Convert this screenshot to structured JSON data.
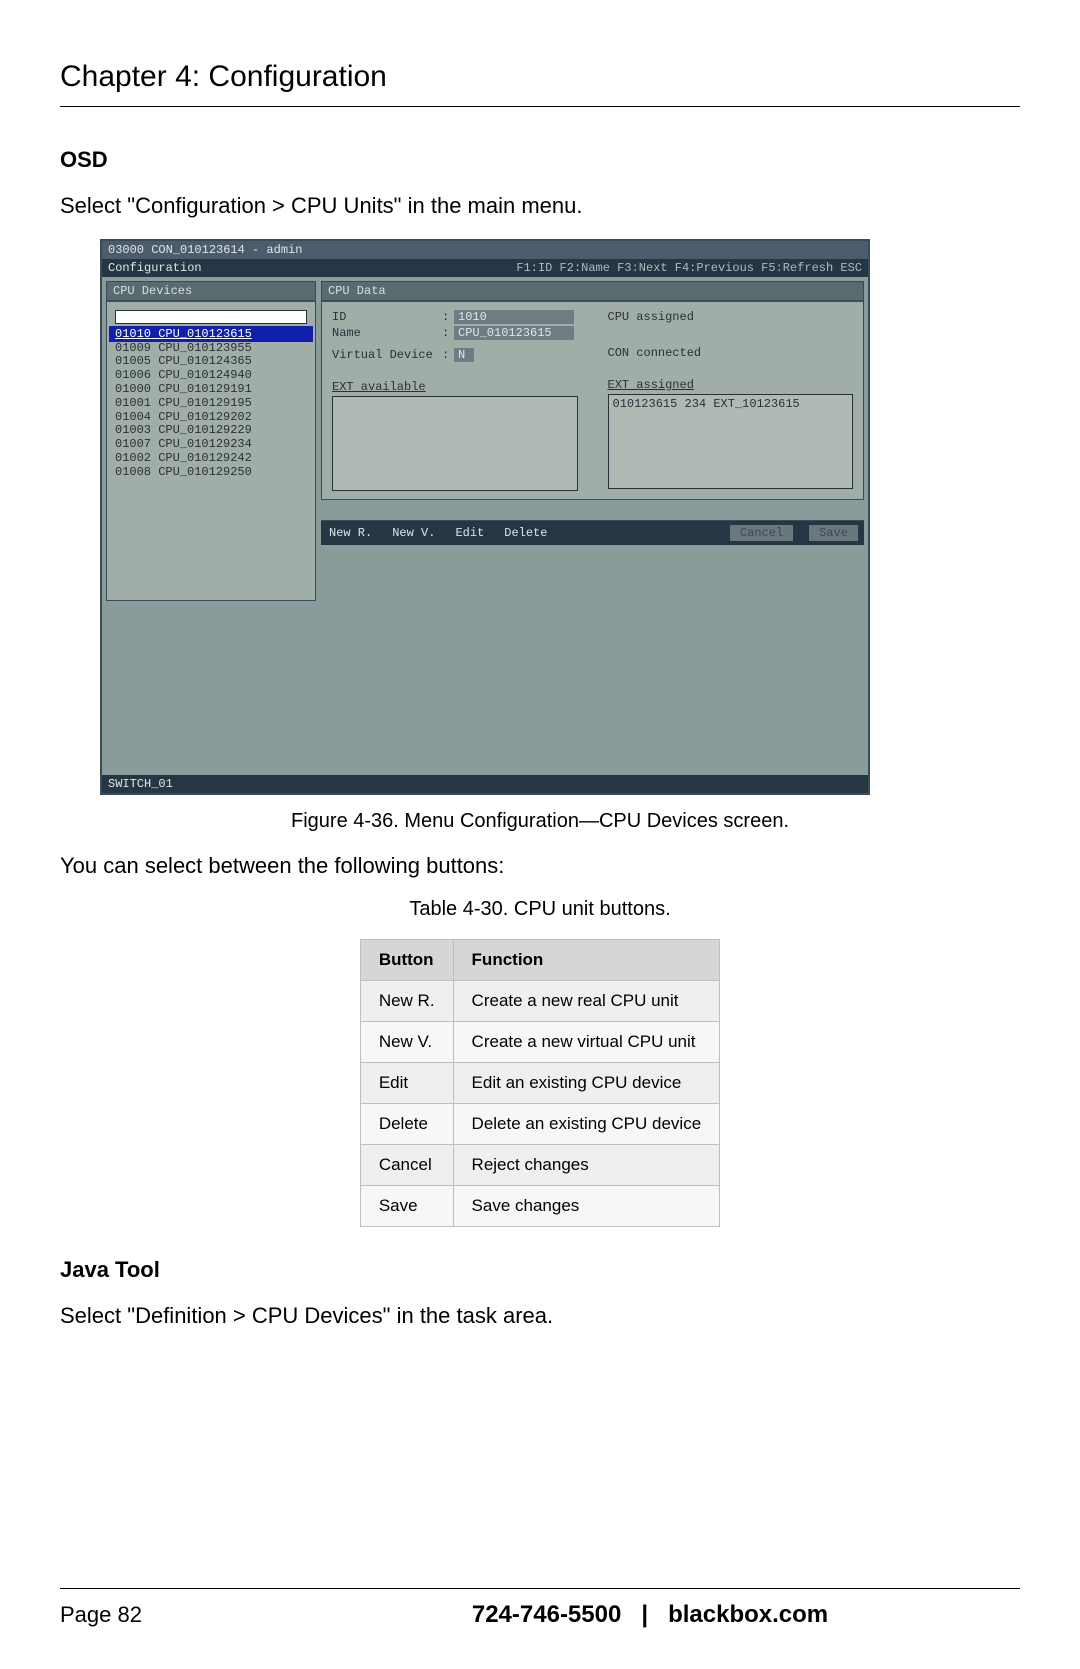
{
  "chapterTitle": "Chapter 4: Configuration",
  "sections": {
    "osd": {
      "title": "OSD",
      "intro": "Select \"Configuration > CPU Units\" in the main menu."
    },
    "java": {
      "title": "Java Tool",
      "intro": "Select \"Definition > CPU Devices\" in the task area."
    }
  },
  "osdScreen": {
    "titlebar": "03000 CON_010123614 - admin",
    "topbar": {
      "left": "Configuration",
      "right": "F1:ID  F2:Name  F3:Next  F4:Previous  F5:Refresh  ESC"
    },
    "leftPanelTitle": "CPU Devices",
    "rightPanelTitle": "CPU Data",
    "selected": "01010 CPU_010123615",
    "list": [
      "01009 CPU_010123955",
      "01005 CPU_010124365",
      "01006 CPU_010124940",
      "01000 CPU_010129191",
      "01001 CPU_010129195",
      "01004 CPU_010129202",
      "01003 CPU_010129229",
      "01007 CPU_010129234",
      "01002 CPU_010129242",
      "01008 CPU_010129250"
    ],
    "fields": {
      "idLabel": "ID",
      "idValue": "1010",
      "nameLabel": "Name",
      "nameValue": "CPU_010123615",
      "vdevLabel": "Virtual Device",
      "vdevValue": "N",
      "cpuAssigned": "CPU assigned",
      "conConnected": "CON connected",
      "extAvailable": "EXT available",
      "extAssigned": "EXT assigned",
      "extAssignedValue": "010123615 234 EXT_10123615"
    },
    "buttons": {
      "newR": "New R.",
      "newV": "New V.",
      "edit": "Edit",
      "delete": "Delete",
      "cancel": "Cancel",
      "save": "Save"
    },
    "status": "SWITCH_01"
  },
  "figureCaption": "Figure 4-36. Menu Configuration—CPU Devices screen.",
  "between": "You can select between the following buttons:",
  "tableCaption": "Table 4-30. CPU unit buttons.",
  "table": {
    "headers": {
      "button": "Button",
      "function": "Function"
    },
    "rows": [
      {
        "button": "New R.",
        "function": "Create a new real CPU unit"
      },
      {
        "button": "New V.",
        "function": "Create a new virtual CPU unit"
      },
      {
        "button": "Edit",
        "function": "Edit an existing CPU device"
      },
      {
        "button": "Delete",
        "function": "Delete an existing CPU device"
      },
      {
        "button": "Cancel",
        "function": "Reject changes"
      },
      {
        "button": "Save",
        "function": "Save changes"
      }
    ]
  },
  "footer": {
    "page": "Page 82",
    "phone": "724-746-5500",
    "sep": "|",
    "site": "blackbox.com"
  }
}
